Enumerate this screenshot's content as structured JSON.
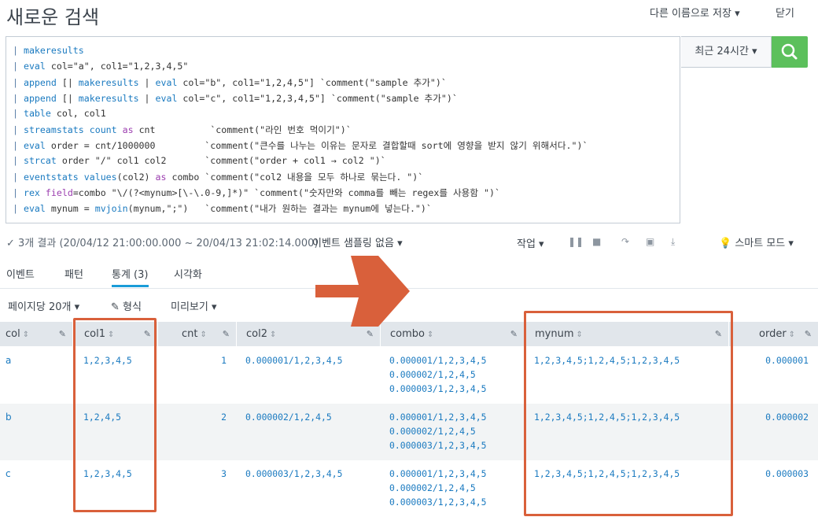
{
  "header": {
    "title": "새로운 검색",
    "save_as": "다른 이름으로 저장 ▾",
    "close": "닫기"
  },
  "query": {
    "lines": [
      [
        "| ",
        "makeresults"
      ],
      [
        "| ",
        "eval",
        " col=\"a\", col1=\"1,2,3,4,5\""
      ],
      [
        "| ",
        "append",
        " [| makeresults | eval col=\"b\", col1=\"1,2,4,5\"] `comment(\"sample 추가\")`"
      ],
      [
        "| ",
        "append",
        " [| makeresults | eval col=\"c\", col1=\"1,2,3,4,5\"] `comment(\"sample 추가\")`"
      ],
      [
        "| ",
        "table",
        " col, col1"
      ],
      [
        "| ",
        "streamstats",
        " count as cnt          `comment(\"라인 번호 먹이기\")`"
      ],
      [
        "| ",
        "eval",
        " order = cnt/1000000         `comment(\"큰수를 나누는 이유는 문자로 결합할때 sort에 영향을 받지 않기 위해서다.\")`"
      ],
      [
        "| ",
        "strcat",
        " order \"/\" col1 col2       `comment(\"order + col1 → col2 \")`"
      ],
      [
        "| ",
        "eventstats",
        " values(col2) as combo `comment(\"col2 내용을 모두 하나로 묶는다. \")`"
      ],
      [
        "| ",
        "rex",
        " field=combo \"\\/(?<mynum>[\\-\\.0-9,]*)\" `comment(\"숫자만와 comma를 빼는 regex를 사용함 \")`"
      ],
      [
        "| ",
        "eval",
        " mynum = mvjoin(mynum,\";\")   `comment(\"내가 원하는 결과는 mynum에 넣는다.\")`"
      ]
    ]
  },
  "time_picker": {
    "label": "최근 24시간 ▾"
  },
  "status": {
    "result_text": "✓ 3개 결과 (20/04/12 21:00:00.000 ~ 20/04/13 21:02:14.000)",
    "sampling": "이벤트 샘플링 없음 ▾",
    "job": "작업 ▾",
    "smart_mode": "💡 스마트 모드 ▾"
  },
  "tabs": [
    "이벤트",
    "패턴",
    "통계 (3)",
    "시각화"
  ],
  "toolbar": {
    "per_page": "페이지당 20개 ▾",
    "format": "✎ 형식",
    "preview": "미리보기 ▾"
  },
  "columns": [
    "col",
    "col1",
    "cnt",
    "col2",
    "combo",
    "mynum",
    "order"
  ],
  "rows": [
    {
      "col": "a",
      "col1": "1,2,3,4,5",
      "cnt": "1",
      "col2": "0.000001/1,2,3,4,5",
      "combo": [
        "0.000001/1,2,3,4,5",
        "0.000002/1,2,4,5",
        "0.000003/1,2,3,4,5"
      ],
      "mynum": "1,2,3,4,5;1,2,4,5;1,2,3,4,5",
      "order": "0.000001"
    },
    {
      "col": "b",
      "col1": "1,2,4,5",
      "cnt": "2",
      "col2": "0.000002/1,2,4,5",
      "combo": [
        "0.000001/1,2,3,4,5",
        "0.000002/1,2,4,5",
        "0.000003/1,2,3,4,5"
      ],
      "mynum": "1,2,3,4,5;1,2,4,5;1,2,3,4,5",
      "order": "0.000002"
    },
    {
      "col": "c",
      "col1": "1,2,3,4,5",
      "cnt": "3",
      "col2": "0.000003/1,2,3,4,5",
      "combo": [
        "0.000001/1,2,3,4,5",
        "0.000002/1,2,4,5",
        "0.000003/1,2,3,4,5"
      ],
      "mynum": "1,2,3,4,5;1,2,4,5;1,2,3,4,5",
      "order": "0.000003"
    }
  ],
  "colors": {
    "accent": "#1a9cd8",
    "search_button": "#5cc05c",
    "highlight": "#d9603b",
    "link": "#1a7ac0"
  }
}
